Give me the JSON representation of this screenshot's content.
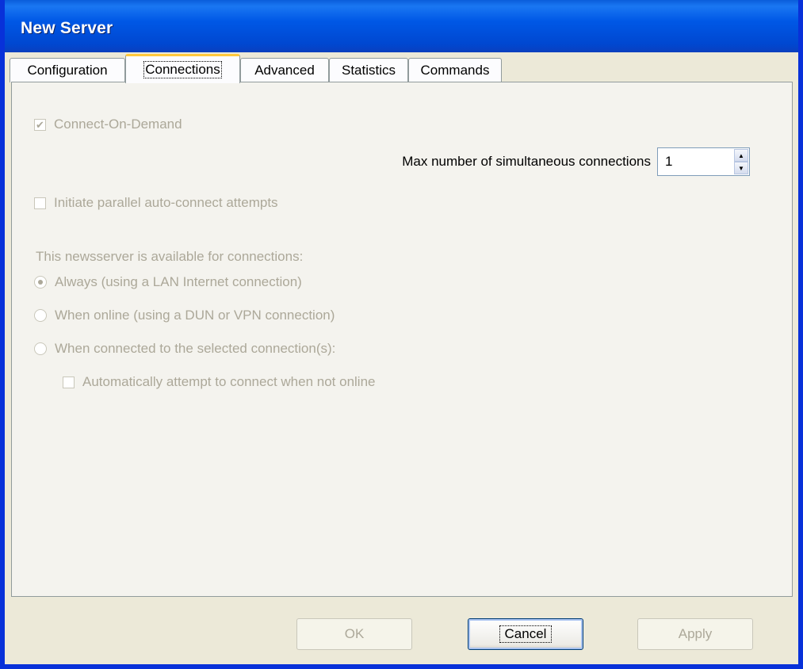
{
  "window": {
    "title": "New Server"
  },
  "tabs": [
    {
      "label": "Configuration"
    },
    {
      "label": "Connections"
    },
    {
      "label": "Advanced"
    },
    {
      "label": "Statistics"
    },
    {
      "label": "Commands"
    }
  ],
  "active_tab": "Connections",
  "connections": {
    "connect_on_demand": {
      "label": "Connect-On-Demand",
      "checked": true,
      "enabled": false
    },
    "max_connections": {
      "label": "Max number of simultaneous connections",
      "value": "1"
    },
    "parallel": {
      "label": "Initiate parallel auto-connect attempts",
      "checked": false,
      "enabled": false
    },
    "availability_heading": "This newsserver is available for connections:",
    "options": [
      {
        "label": "Always (using a LAN Internet connection)",
        "selected": true
      },
      {
        "label": "When online (using a DUN or VPN connection)",
        "selected": false
      },
      {
        "label": "When connected to the selected connection(s):",
        "selected": false
      }
    ],
    "auto_attempt": {
      "label": "Automatically attempt to connect when not online",
      "checked": false
    }
  },
  "buttons": {
    "ok": "OK",
    "cancel": "Cancel",
    "apply": "Apply"
  },
  "icons": {
    "check": "checkmark-icon",
    "spin_up": "arrow-up-icon",
    "spin_down": "arrow-down-icon"
  }
}
